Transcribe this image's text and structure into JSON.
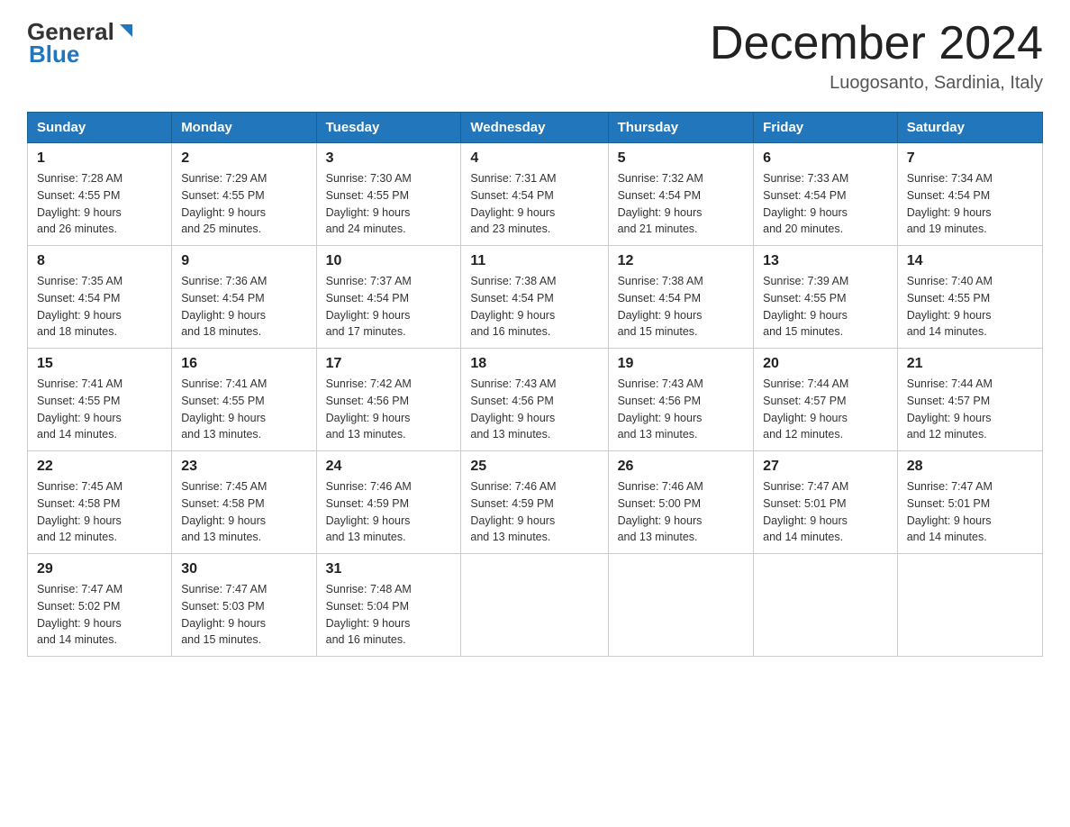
{
  "header": {
    "logo_general": "General",
    "logo_blue": "Blue",
    "month_title": "December 2024",
    "location": "Luogosanto, Sardinia, Italy"
  },
  "days_of_week": [
    "Sunday",
    "Monday",
    "Tuesday",
    "Wednesday",
    "Thursday",
    "Friday",
    "Saturday"
  ],
  "weeks": [
    [
      {
        "day": "1",
        "sunrise": "7:28 AM",
        "sunset": "4:55 PM",
        "daylight": "9 hours and 26 minutes."
      },
      {
        "day": "2",
        "sunrise": "7:29 AM",
        "sunset": "4:55 PM",
        "daylight": "9 hours and 25 minutes."
      },
      {
        "day": "3",
        "sunrise": "7:30 AM",
        "sunset": "4:55 PM",
        "daylight": "9 hours and 24 minutes."
      },
      {
        "day": "4",
        "sunrise": "7:31 AM",
        "sunset": "4:54 PM",
        "daylight": "9 hours and 23 minutes."
      },
      {
        "day": "5",
        "sunrise": "7:32 AM",
        "sunset": "4:54 PM",
        "daylight": "9 hours and 21 minutes."
      },
      {
        "day": "6",
        "sunrise": "7:33 AM",
        "sunset": "4:54 PM",
        "daylight": "9 hours and 20 minutes."
      },
      {
        "day": "7",
        "sunrise": "7:34 AM",
        "sunset": "4:54 PM",
        "daylight": "9 hours and 19 minutes."
      }
    ],
    [
      {
        "day": "8",
        "sunrise": "7:35 AM",
        "sunset": "4:54 PM",
        "daylight": "9 hours and 18 minutes."
      },
      {
        "day": "9",
        "sunrise": "7:36 AM",
        "sunset": "4:54 PM",
        "daylight": "9 hours and 18 minutes."
      },
      {
        "day": "10",
        "sunrise": "7:37 AM",
        "sunset": "4:54 PM",
        "daylight": "9 hours and 17 minutes."
      },
      {
        "day": "11",
        "sunrise": "7:38 AM",
        "sunset": "4:54 PM",
        "daylight": "9 hours and 16 minutes."
      },
      {
        "day": "12",
        "sunrise": "7:38 AM",
        "sunset": "4:54 PM",
        "daylight": "9 hours and 15 minutes."
      },
      {
        "day": "13",
        "sunrise": "7:39 AM",
        "sunset": "4:55 PM",
        "daylight": "9 hours and 15 minutes."
      },
      {
        "day": "14",
        "sunrise": "7:40 AM",
        "sunset": "4:55 PM",
        "daylight": "9 hours and 14 minutes."
      }
    ],
    [
      {
        "day": "15",
        "sunrise": "7:41 AM",
        "sunset": "4:55 PM",
        "daylight": "9 hours and 14 minutes."
      },
      {
        "day": "16",
        "sunrise": "7:41 AM",
        "sunset": "4:55 PM",
        "daylight": "9 hours and 13 minutes."
      },
      {
        "day": "17",
        "sunrise": "7:42 AM",
        "sunset": "4:56 PM",
        "daylight": "9 hours and 13 minutes."
      },
      {
        "day": "18",
        "sunrise": "7:43 AM",
        "sunset": "4:56 PM",
        "daylight": "9 hours and 13 minutes."
      },
      {
        "day": "19",
        "sunrise": "7:43 AM",
        "sunset": "4:56 PM",
        "daylight": "9 hours and 13 minutes."
      },
      {
        "day": "20",
        "sunrise": "7:44 AM",
        "sunset": "4:57 PM",
        "daylight": "9 hours and 12 minutes."
      },
      {
        "day": "21",
        "sunrise": "7:44 AM",
        "sunset": "4:57 PM",
        "daylight": "9 hours and 12 minutes."
      }
    ],
    [
      {
        "day": "22",
        "sunrise": "7:45 AM",
        "sunset": "4:58 PM",
        "daylight": "9 hours and 12 minutes."
      },
      {
        "day": "23",
        "sunrise": "7:45 AM",
        "sunset": "4:58 PM",
        "daylight": "9 hours and 13 minutes."
      },
      {
        "day": "24",
        "sunrise": "7:46 AM",
        "sunset": "4:59 PM",
        "daylight": "9 hours and 13 minutes."
      },
      {
        "day": "25",
        "sunrise": "7:46 AM",
        "sunset": "4:59 PM",
        "daylight": "9 hours and 13 minutes."
      },
      {
        "day": "26",
        "sunrise": "7:46 AM",
        "sunset": "5:00 PM",
        "daylight": "9 hours and 13 minutes."
      },
      {
        "day": "27",
        "sunrise": "7:47 AM",
        "sunset": "5:01 PM",
        "daylight": "9 hours and 14 minutes."
      },
      {
        "day": "28",
        "sunrise": "7:47 AM",
        "sunset": "5:01 PM",
        "daylight": "9 hours and 14 minutes."
      }
    ],
    [
      {
        "day": "29",
        "sunrise": "7:47 AM",
        "sunset": "5:02 PM",
        "daylight": "9 hours and 14 minutes."
      },
      {
        "day": "30",
        "sunrise": "7:47 AM",
        "sunset": "5:03 PM",
        "daylight": "9 hours and 15 minutes."
      },
      {
        "day": "31",
        "sunrise": "7:48 AM",
        "sunset": "5:04 PM",
        "daylight": "9 hours and 16 minutes."
      },
      null,
      null,
      null,
      null
    ]
  ]
}
